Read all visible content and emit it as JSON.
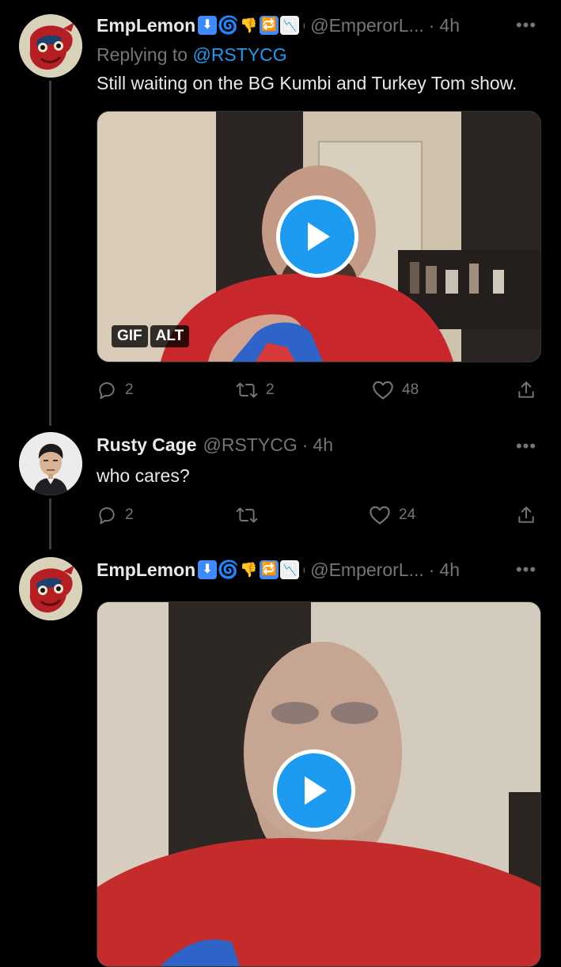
{
  "tweets": [
    {
      "name": "EmpLemon",
      "badges": [
        "arrow-down-emoji",
        "cyclone-emoji",
        "thumbs-down-emoji",
        "repeat-emoji",
        "chart-decreasing-emoji"
      ],
      "handle": "@EmperorL...",
      "time": "4h",
      "replying_label": "Replying to",
      "replying_to": "@RSTYCG",
      "text": "Still waiting on the BG Kumbi and Turkey Tom show.",
      "media": {
        "type": "GIF",
        "badge": "GIF",
        "alt_badge": "ALT"
      },
      "replies": "2",
      "retweets": "2",
      "likes": "48"
    },
    {
      "name": "Rusty Cage",
      "handle": "@RSTYCG",
      "time": "4h",
      "text": "who cares?",
      "replies": "2",
      "retweets": "",
      "likes": "24"
    },
    {
      "name": "EmpLemon",
      "badges": [
        "arrow-down-emoji",
        "cyclone-emoji",
        "thumbs-down-emoji",
        "repeat-emoji",
        "chart-decreasing-emoji"
      ],
      "handle": "@EmperorL...",
      "time": "4h",
      "media": {
        "type": "video"
      }
    }
  ],
  "colors": {
    "background": "#000000",
    "text": "#e7e9ea",
    "muted": "#71767b",
    "accent": "#1d9bf0"
  }
}
